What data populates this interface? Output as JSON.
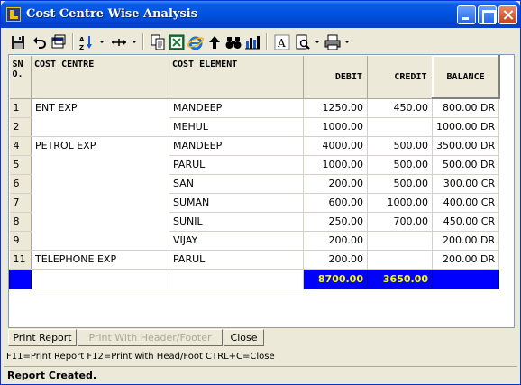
{
  "window": {
    "title": "Cost Centre Wise Analysis"
  },
  "toolbar": {
    "items": [
      "save-icon",
      "undo-icon",
      "open-icon",
      "sort-icon",
      "column-width-icon",
      "copy-icon",
      "excel-icon",
      "internet-icon",
      "up-arrow-icon",
      "find-icon",
      "chart-icon",
      "font-icon",
      "print-preview-icon",
      "printer-icon"
    ]
  },
  "grid": {
    "columns": [
      "SN\nO.",
      "COST CENTRE",
      "COST ELEMENT",
      "DEBIT",
      "CREDIT",
      "BALANCE"
    ],
    "rows": [
      {
        "sn": "1",
        "centre": "ENT EXP",
        "element": "MANDEEP",
        "debit": "1250.00",
        "credit": "450.00",
        "balance": "800.00 DR"
      },
      {
        "sn": "2",
        "centre": "",
        "element": "MEHUL",
        "debit": "1000.00",
        "credit": "",
        "balance": "1000.00 DR"
      },
      {
        "sn": "4",
        "centre": "PETROL EXP",
        "element": "MANDEEP",
        "debit": "4000.00",
        "credit": "500.00",
        "balance": "3500.00 DR"
      },
      {
        "sn": "5",
        "centre": "",
        "element": "PARUL",
        "debit": "1000.00",
        "credit": "500.00",
        "balance": "500.00 DR"
      },
      {
        "sn": "6",
        "centre": "",
        "element": "SAN",
        "debit": "200.00",
        "credit": "500.00",
        "balance": "300.00 CR"
      },
      {
        "sn": "7",
        "centre": "",
        "element": "SUMAN",
        "debit": "600.00",
        "credit": "1000.00",
        "balance": "400.00 CR"
      },
      {
        "sn": "8",
        "centre": "",
        "element": "SUNIL",
        "debit": "250.00",
        "credit": "700.00",
        "balance": "450.00 CR"
      },
      {
        "sn": "9",
        "centre": "",
        "element": "VIJAY",
        "debit": "200.00",
        "credit": "",
        "balance": "200.00 DR"
      },
      {
        "sn": "11",
        "centre": "TELEPHONE EXP",
        "element": "PARUL",
        "debit": "200.00",
        "credit": "",
        "balance": "200.00 DR"
      }
    ],
    "totals": {
      "debit": "8700.00",
      "credit": "3650.00"
    }
  },
  "buttons": {
    "print_report": "Print Report",
    "print_header_footer": "Print With Header/Footer",
    "close": "Close"
  },
  "hint": "F11=Print Report  F12=Print with Head/Foot  CTRL+C=Close",
  "status": "Report Created.",
  "colors": {
    "title_bar": "#0054E3",
    "selection": "#0000FF",
    "total_text": "#FFFF00"
  }
}
